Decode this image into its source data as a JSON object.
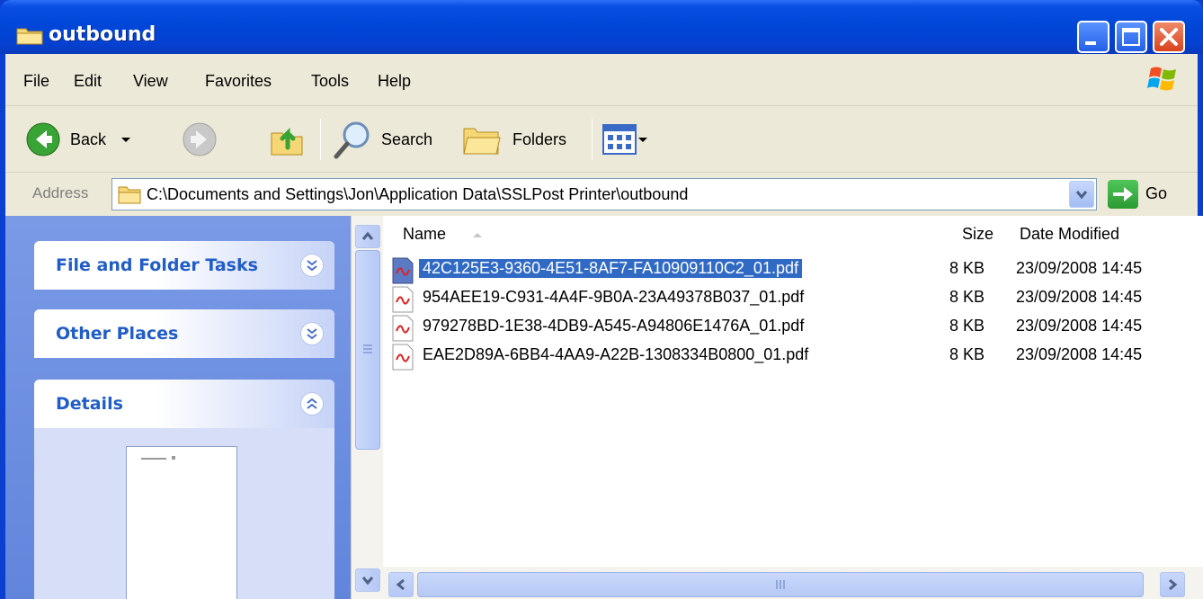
{
  "window": {
    "title": "outbound",
    "folder_icon": "folder-icon",
    "controls": [
      "minimize-icon",
      "maximize-icon",
      "close-icon"
    ]
  },
  "menu": {
    "items": [
      "File",
      "Edit",
      "View",
      "Favorites",
      "Tools",
      "Help"
    ]
  },
  "toolbar": {
    "back_label": "Back",
    "search_label": "Search",
    "folders_label": "Folders",
    "views_icon": "views-icon"
  },
  "address": {
    "label": "Address",
    "path": "C:\\Documents and Settings\\Jon\\Application Data\\SSLPost Printer\\outbound",
    "go_label": "Go"
  },
  "taskpane": {
    "sections": [
      {
        "title": "File and Folder Tasks",
        "state": "collapsed"
      },
      {
        "title": "Other Places",
        "state": "collapsed"
      },
      {
        "title": "Details",
        "state": "expanded"
      }
    ]
  },
  "filelist": {
    "columns": {
      "name": "Name",
      "size": "Size",
      "date": "Date Modified"
    },
    "files": [
      {
        "name": "42C125E3-9360-4E51-8AF7-FA10909110C2_01.pdf",
        "size": "8 KB",
        "date": "23/09/2008 14:45",
        "selected": true
      },
      {
        "name": "954AEE19-C931-4A4F-9B0A-23A49378B037_01.pdf",
        "size": "8 KB",
        "date": "23/09/2008 14:45",
        "selected": false
      },
      {
        "name": "979278BD-1E38-4DB9-A545-A94806E1476A_01.pdf",
        "size": "8 KB",
        "date": "23/09/2008 14:45",
        "selected": false
      },
      {
        "name": "EAE2D89A-6BB4-4AA9-A22B-1308334B0800_01.pdf",
        "size": "8 KB",
        "date": "23/09/2008 14:45",
        "selected": false
      }
    ]
  },
  "colors": {
    "titlebar": "#0047d8",
    "taskpane": "#7a9ae6",
    "selection": "#316ac5",
    "task_title": "#215dc6"
  }
}
